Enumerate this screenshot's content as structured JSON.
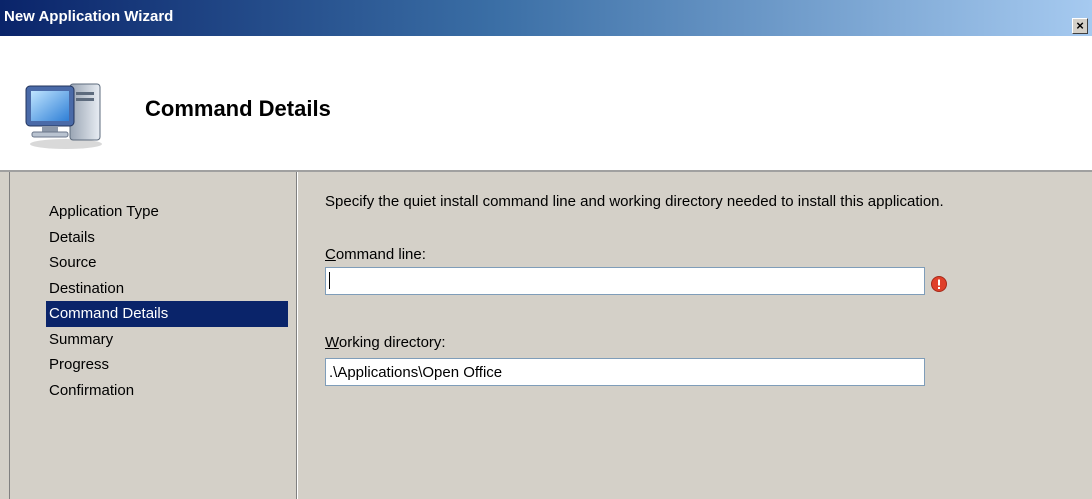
{
  "window": {
    "title": "New Application Wizard",
    "close_label": "×"
  },
  "header": {
    "title": "Command Details",
    "icon": "computer-icon"
  },
  "nav": {
    "items": [
      {
        "label": "Application Type",
        "active": false
      },
      {
        "label": "Details",
        "active": false
      },
      {
        "label": "Source",
        "active": false
      },
      {
        "label": "Destination",
        "active": false
      },
      {
        "label": "Command Details",
        "active": true
      },
      {
        "label": "Summary",
        "active": false
      },
      {
        "label": "Progress",
        "active": false
      },
      {
        "label": "Confirmation",
        "active": false
      }
    ]
  },
  "main": {
    "instruction": "Specify the quiet install command line and working directory needed to install this application.",
    "command_line": {
      "label_accel": "C",
      "label_rest": "ommand line:",
      "value": "",
      "error_icon": "error-icon"
    },
    "working_directory": {
      "label_accel": "W",
      "label_rest": "orking directory:",
      "value": ".\\Applications\\Open Office"
    }
  },
  "colors": {
    "titlebar_start": "#0a246a",
    "titlebar_end": "#a6caf0",
    "selection": "#0a246a",
    "face": "#d4d0c8",
    "error": "#e0402a"
  }
}
